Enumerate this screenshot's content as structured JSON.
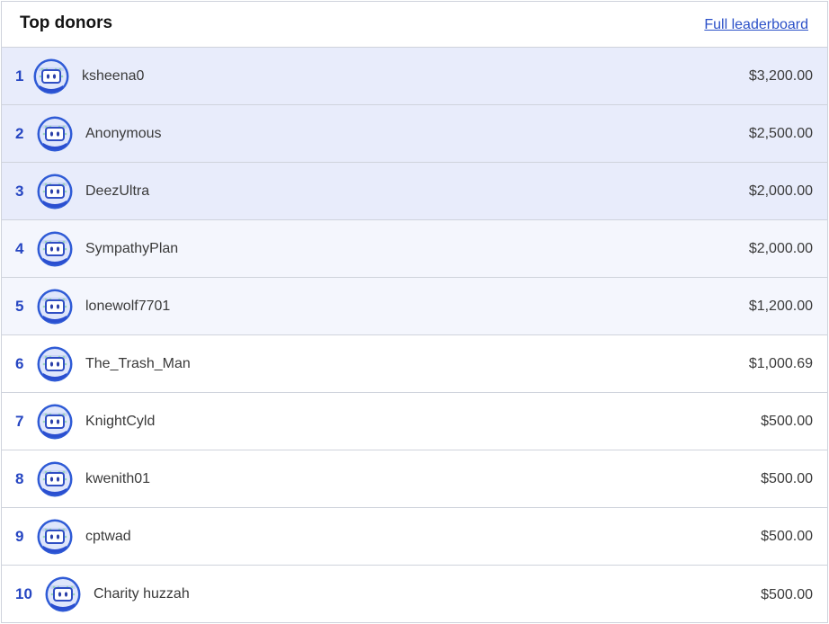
{
  "header": {
    "title": "Top donors",
    "link_label": "Full leaderboard"
  },
  "colors": {
    "accent": "#2646c2",
    "link": "#2b50c8",
    "row_highlight_strong": "#e8ecfb",
    "row_highlight_light": "#f4f6fd"
  },
  "avatar_icon": "robot-face-icon",
  "donors": [
    {
      "rank": "1",
      "name": "ksheena0",
      "amount": "$3,200.00"
    },
    {
      "rank": "2",
      "name": "Anonymous",
      "amount": "$2,500.00"
    },
    {
      "rank": "3",
      "name": "DeezUltra",
      "amount": "$2,000.00"
    },
    {
      "rank": "4",
      "name": "SympathyPlan",
      "amount": "$2,000.00"
    },
    {
      "rank": "5",
      "name": "lonewolf7701",
      "amount": "$1,200.00"
    },
    {
      "rank": "6",
      "name": "The_Trash_Man",
      "amount": "$1,000.69"
    },
    {
      "rank": "7",
      "name": "KnightCyld",
      "amount": "$500.00"
    },
    {
      "rank": "8",
      "name": "kwenith01",
      "amount": "$500.00"
    },
    {
      "rank": "9",
      "name": "cptwad",
      "amount": "$500.00"
    },
    {
      "rank": "10",
      "name": "Charity huzzah",
      "amount": "$500.00"
    }
  ]
}
